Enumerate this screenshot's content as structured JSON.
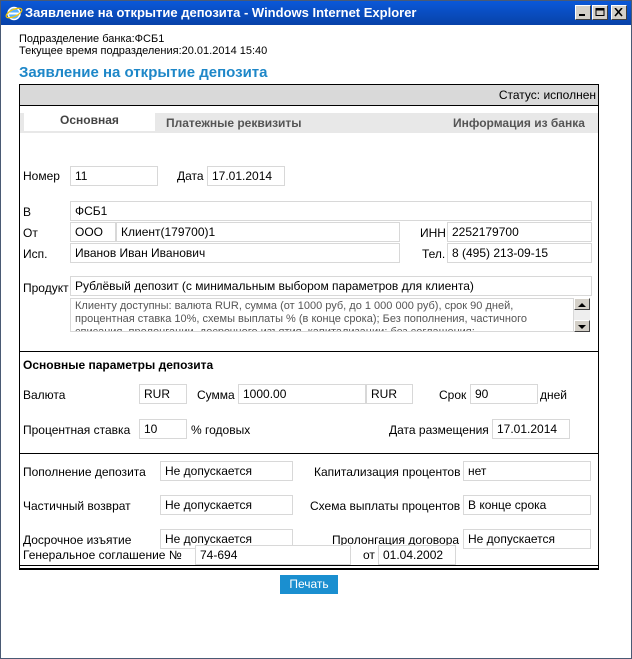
{
  "window": {
    "title": "Заявление на открытие депозита - Windows Internet Explorer",
    "colors": {
      "title_bar": "#0a58d8",
      "accent": "#1e87c8",
      "button": "#1a8fd0"
    }
  },
  "header": {
    "branch": "Подразделение банка:ФСБ1",
    "current_time": "Текущее время подразделения:20.01.2014 15:40",
    "page_title": "Заявление на открытие депозита"
  },
  "status": {
    "label": "Статус:",
    "value": "исполнен"
  },
  "tabs": [
    "Основная",
    "Платежные реквизиты",
    "Информация из банка"
  ],
  "form": {
    "number_label": "Номер",
    "number_value": "11",
    "date_label": "Дата",
    "date_value": "17.01.2014",
    "to_label": "В",
    "to_value": "ФСБ1",
    "from_label": "От",
    "from_type": "ООО",
    "from_name": "Клиент(179700)1",
    "inn_label": "ИНН",
    "inn_value": "2252179700",
    "executor_label": "Исп.",
    "executor_value": "Иванов Иван Иванович",
    "phone_label": "Тел.",
    "phone_value": "8 (495) 213-09-15",
    "product_label": "Продукт",
    "product_value": "Рублёвый депозит (с минимальным выбором параметров для клиента)",
    "product_description": "Клиенту доступны: валюта RUR, сумма (от 1000 руб, до 1 000 000 руб), срок 90 дней, процентная ставка 10%, схемы выплаты % (в конце срока); Без пополнения, частичного списания, пролонгации, досрочного изъятия, капитализации; без соглашения;"
  },
  "params": {
    "title": "Основные параметры депозита",
    "currency_label": "Валюта",
    "currency_value": "RUR",
    "amount_label": "Сумма",
    "amount_value": "1000.00",
    "amount_currency": "RUR",
    "term_label": "Срок",
    "term_value": "90",
    "term_unit": "дней",
    "rate_label": "Процентная ставка",
    "rate_value": "10",
    "rate_unit": "% годовых",
    "placement_date_label": "Дата размещения",
    "placement_date_value": "17.01.2014"
  },
  "options": {
    "replenish_label": "Пополнение депозита",
    "replenish_value": "Не допускается",
    "capitalization_label": "Капитализация процентов",
    "capitalization_value": "нет",
    "partial_label": "Частичный возврат",
    "partial_value": "Не допускается",
    "payout_label": "Схема выплаты процентов",
    "payout_value": "В конце срока",
    "early_label": "Досрочное изъятие",
    "early_value": "Не допускается",
    "prolong_label": "Пролонгация договора",
    "prolong_value": "Не допускается"
  },
  "agreement": {
    "label": "Генеральное соглашение №",
    "number": "74-694",
    "from_label": "от",
    "date": "01.04.2002"
  },
  "actions": {
    "print_label": "Печать"
  }
}
